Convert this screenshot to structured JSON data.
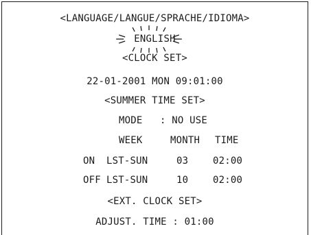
{
  "menu": {
    "language_heading": "<LANGUAGE/LANGUE/SPRACHE/IDIOMA>",
    "language_value": "ENGLISH",
    "clock_set_heading": "<CLOCK SET>",
    "clock_datetime": "22-01-2001 MON 09:01:00",
    "summer_time_heading": "<SUMMER TIME SET>",
    "mode_label": "MODE",
    "mode_value": ": NO USE",
    "table": {
      "headers": [
        "WEEK",
        "MONTH",
        "TIME"
      ],
      "rows": [
        {
          "label": "ON",
          "week": "LST-SUN",
          "month": "03",
          "time": "02:00"
        },
        {
          "label": "OFF",
          "week": "LST-SUN",
          "month": "10",
          "time": "02:00"
        }
      ]
    },
    "ext_clock_heading": "<EXT. CLOCK SET>",
    "adjust_time": "ADJUST. TIME : 01:00"
  },
  "colors": {
    "text": "#1a1a1a",
    "background": "#ffffff",
    "border": "#1a1a1a"
  },
  "selection_indicator": "blinking-cursor"
}
